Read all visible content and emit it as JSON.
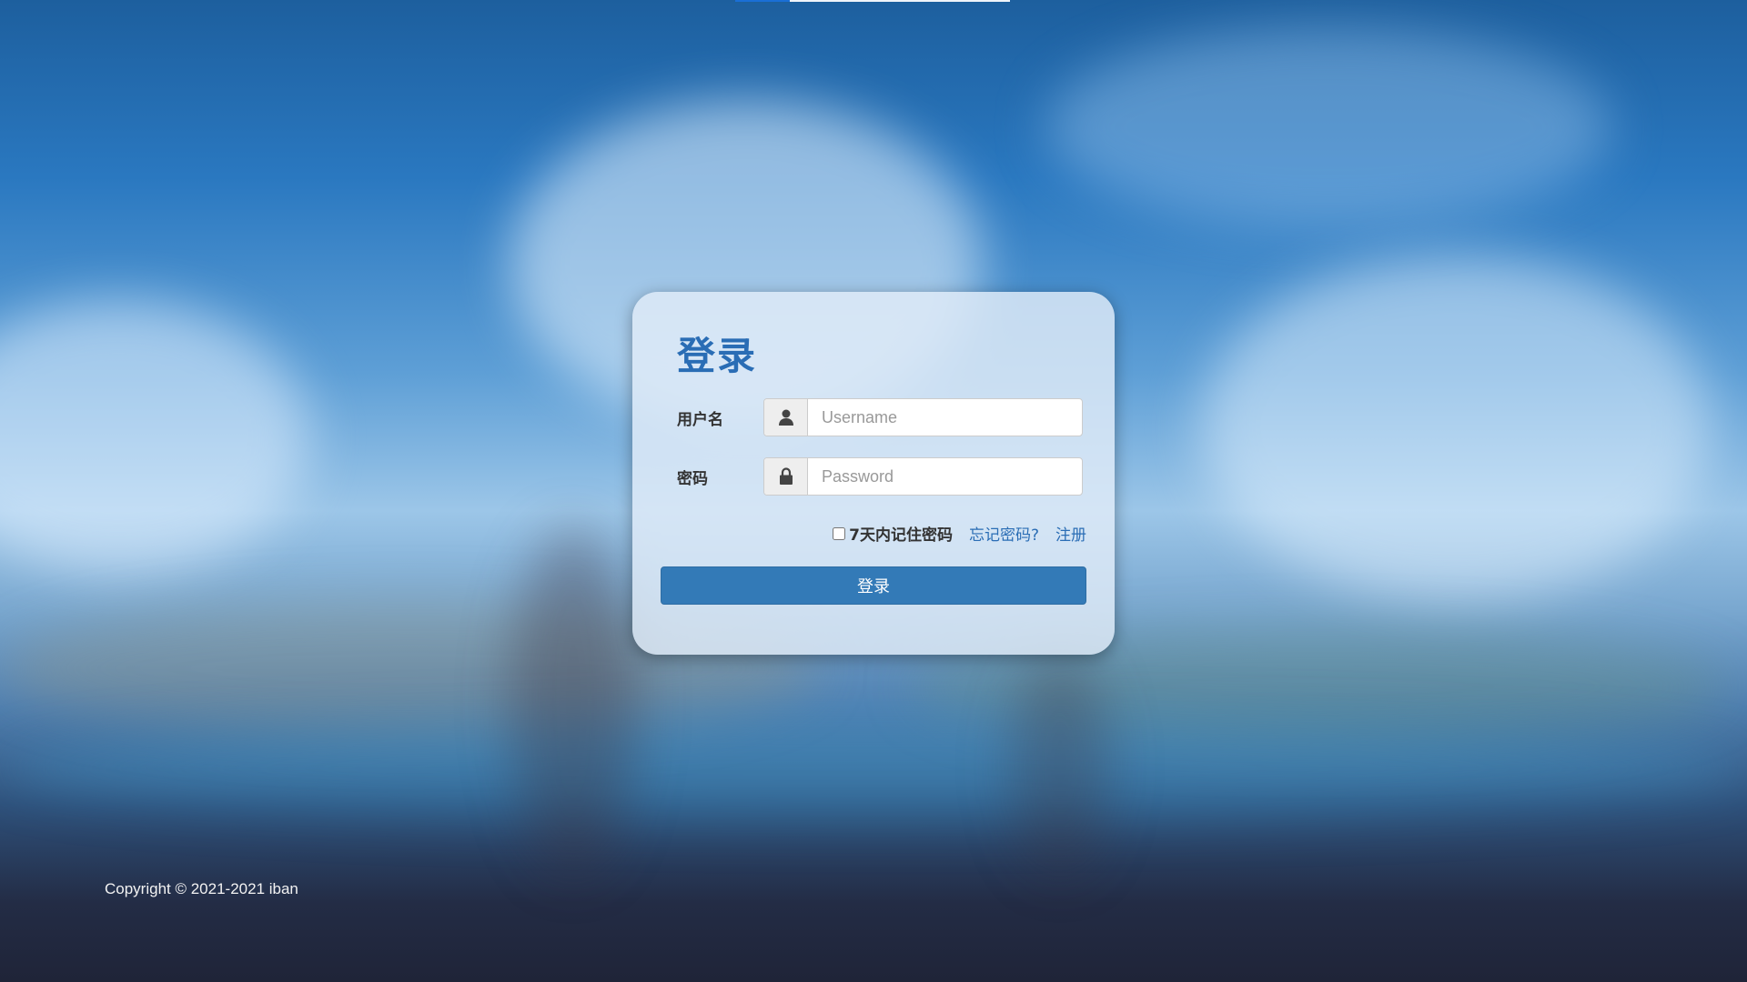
{
  "page": {
    "title": "登录"
  },
  "form": {
    "username_label": "用户名",
    "username_placeholder": "Username",
    "username_icon": "user-icon",
    "password_label": "密码",
    "password_placeholder": "Password",
    "password_icon": "lock-icon",
    "remember_label": "7天内记住密码",
    "remember_checked": false,
    "forgot_link": "忘记密码?",
    "register_link": "注册",
    "login_button": "登录"
  },
  "footer": {
    "copyright": "Copyright © 2021-2021 iban"
  },
  "colors": {
    "primary": "#337ab7",
    "title": "#2a6db5",
    "link": "#2a6db5"
  }
}
